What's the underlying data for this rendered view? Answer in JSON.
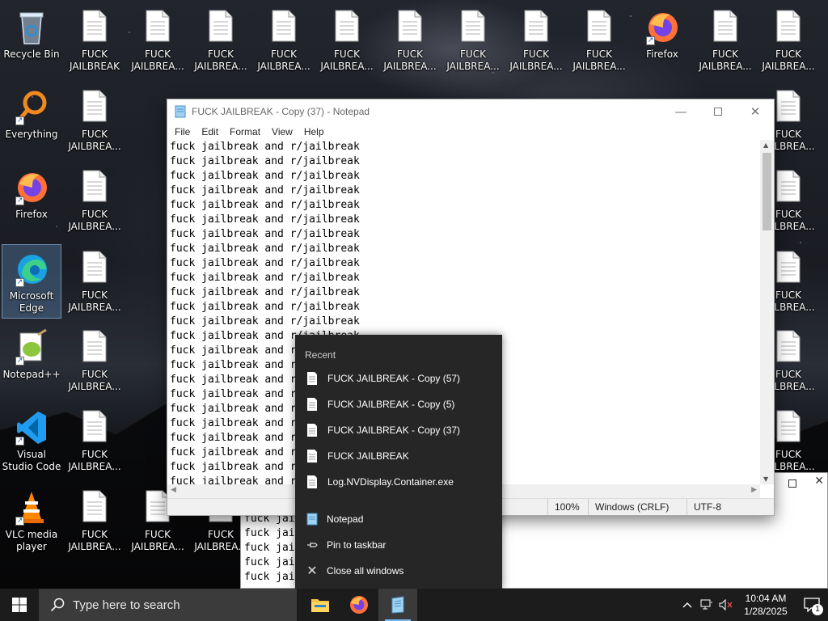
{
  "desktop": {
    "icons": {
      "recycle_bin": "Recycle Bin",
      "everything": "Everything",
      "firefox_left": "Firefox",
      "edge": "Microsoft Edge",
      "notepadpp": "Notepad++",
      "vscode": "Visual Studio Code",
      "vlc": "VLC media player",
      "firefox_top": "Firefox",
      "file_full": "FUCK JAILBREAK",
      "file_trunc": "FUCK JAILBREA...",
      "file_partial": "FUCK JAILBRE"
    }
  },
  "notepad": {
    "title": "FUCK JAILBREAK - Copy (37) - Notepad",
    "menu": [
      "File",
      "Edit",
      "Format",
      "View",
      "Help"
    ],
    "line_text": "fuck jailbreak and r/jailbreak",
    "status": {
      "zoom": "100%",
      "line_endings": "Windows (CRLF)",
      "encoding": "UTF-8"
    }
  },
  "background_window": {
    "line_text": "fuck jai"
  },
  "jumplist": {
    "heading": "Recent",
    "recent": [
      "FUCK JAILBREAK - Copy (57)",
      "FUCK JAILBREAK - Copy (5)",
      "FUCK JAILBREAK - Copy (37)",
      "FUCK JAILBREAK",
      "Log.NVDisplay.Container.exe"
    ],
    "actions": {
      "open": "Notepad",
      "pin": "Pin to taskbar",
      "close_all": "Close all windows"
    }
  },
  "taskbar": {
    "search_placeholder": "Type here to search",
    "time": "10:04 AM",
    "date": "1/28/2025",
    "notification_count": "1"
  },
  "colors": {
    "taskbar": "#1c1c1c",
    "jumplist": "#262626",
    "accent": "#76b9ed"
  }
}
